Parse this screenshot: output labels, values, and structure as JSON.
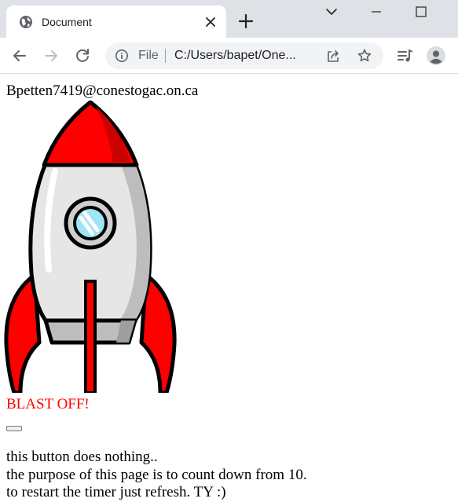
{
  "browser": {
    "tab": {
      "title": "Document",
      "favicon": "globe-icon",
      "close_icon": "close-icon"
    },
    "new_tab_icon": "plus-icon",
    "window_controls": [
      "chevron-down-icon",
      "minimize-icon",
      "maximize-icon"
    ],
    "toolbar": {
      "back_icon": "back-arrow-icon",
      "forward_icon": "forward-arrow-icon",
      "reload_icon": "reload-icon",
      "media_icon": "media-playlist-icon",
      "profile_icon": "profile-icon"
    },
    "omnibox": {
      "info_icon": "info-icon",
      "scheme": "File",
      "url": "C:/Users/bapet/One...",
      "share_icon": "share-icon",
      "star_icon": "star-icon"
    }
  },
  "page": {
    "email": "Bpetten7419@conestogac.on.ca",
    "rocket_image": "rocket-icon",
    "blast_text": "BLAST OFF!",
    "button_label": "",
    "lines": [
      "this button does nothing..",
      "the purpose of this page is to count down from 10.",
      "to restart the timer just refresh. TY :)"
    ],
    "colors": {
      "blast": "#ff0000",
      "rocket_red": "#ff0000",
      "rocket_body": "#e6e6e6",
      "window_glass": "#9fe4f7"
    }
  }
}
